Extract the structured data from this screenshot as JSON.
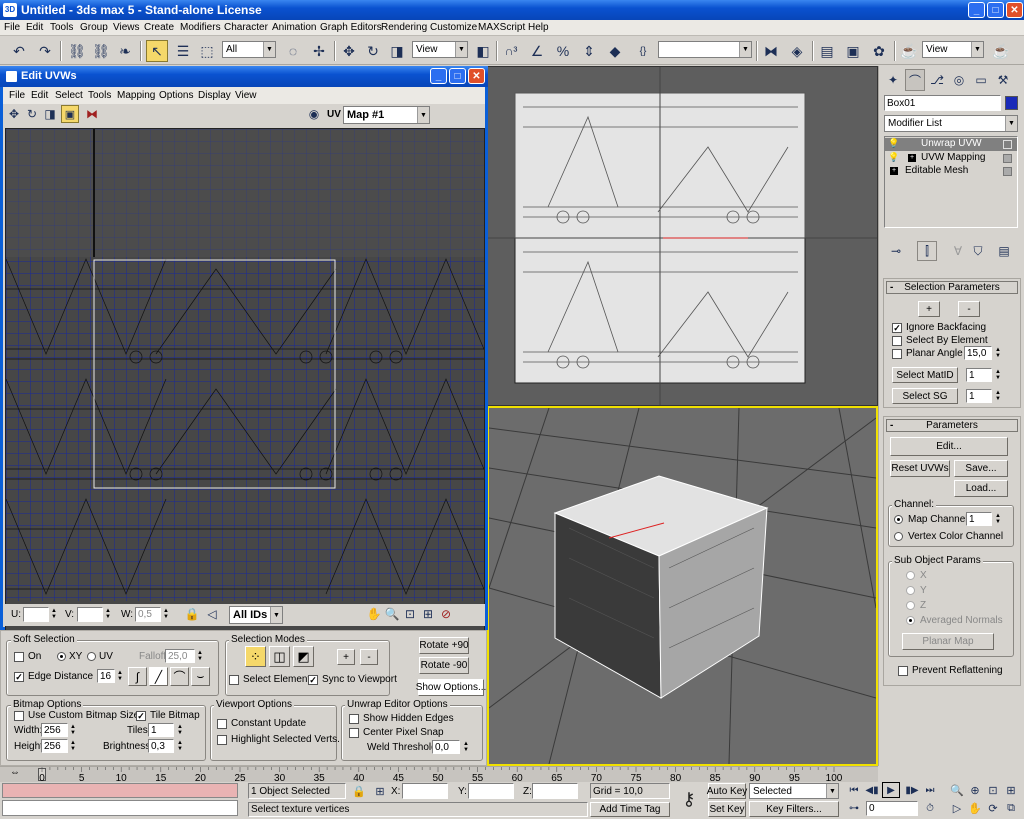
{
  "app": {
    "title": "Untitled - 3ds max 5 - Stand-alone License"
  },
  "menubar": [
    "File",
    "Edit",
    "Tools",
    "Group",
    "Views",
    "Create",
    "Modifiers",
    "Character",
    "Animation",
    "Graph Editors",
    "Rendering",
    "Customize",
    "MAXScript",
    "Help"
  ],
  "toolbar": {
    "selection_filter": "All",
    "ref_coord": "View",
    "named_sets": "",
    "render_type": "View"
  },
  "uvw_editor": {
    "title": "Edit UVWs",
    "menus": [
      "File",
      "Edit",
      "Select",
      "Tools",
      "Mapping",
      "Options",
      "Display",
      "View"
    ],
    "uv_label": "UV",
    "map": "Map #1",
    "u_label": "U:",
    "v_label": "V:",
    "w_label": "W:",
    "w_value": "0,5",
    "ids": "All IDs"
  },
  "soft_selection": {
    "title": "Soft Selection",
    "on": "On",
    "xy": "XY",
    "uv": "UV",
    "falloff_label": "Falloff:",
    "falloff": "25,0",
    "edge_distance": "Edge Distance",
    "edge_value": "16"
  },
  "selection_modes": {
    "title": "Selection Modes",
    "plus": "+",
    "minus": "-",
    "select_element": "Select Element",
    "sync": "Sync to Viewport"
  },
  "rotate": {
    "plus90": "Rotate +90",
    "minus90": "Rotate -90",
    "show_options": "Show Options..."
  },
  "bitmap_options": {
    "title": "Bitmap Options",
    "use_custom": "Use Custom Bitmap Size",
    "tile": "Tile Bitmap",
    "width_label": "Width:",
    "width": "256",
    "height_label": "Height:",
    "height": "256",
    "tiles_label": "Tiles:",
    "tiles": "1",
    "brightness_label": "Brightness:",
    "brightness": "0,3"
  },
  "viewport_options": {
    "title": "Viewport Options",
    "constant": "Constant Update",
    "highlight": "Highlight Selected Verts."
  },
  "unwrap_options": {
    "title": "Unwrap Editor Options",
    "hidden": "Show Hidden Edges",
    "center": "Center Pixel Snap",
    "weld_label": "Weld Threshold:",
    "weld": "0,0"
  },
  "command_panel": {
    "object_name": "Box01",
    "modifier_list": "Modifier List",
    "stack": [
      "Unwrap UVW",
      "UVW Mapping",
      "Editable Mesh"
    ],
    "selection_params": {
      "title": "Selection Parameters",
      "plus": "+",
      "minus": "-",
      "ignore_backfacing": "Ignore Backfacing",
      "select_by_element": "Select By Element",
      "planar_angle": "Planar Angle",
      "planar_value": "15,0",
      "select_matid": "Select MatID",
      "matid": "1",
      "select_sg": "Select SG",
      "sg": "1"
    },
    "parameters": {
      "title": "Parameters",
      "edit": "Edit...",
      "reset": "Reset UVWs",
      "save": "Save...",
      "load": "Load...",
      "channel_title": "Channel:",
      "map_channel": "Map Channel:",
      "map_channel_value": "1",
      "vertex_color": "Vertex Color Channel",
      "sub_title": "Sub Object Params",
      "x": "X",
      "y": "Y",
      "z": "Z",
      "averaged": "Averaged Normals",
      "planar_map": "Planar Map",
      "prevent": "Prevent Reflattening"
    }
  },
  "timeline": {
    "frame": "0",
    "ticks": [
      "0",
      "5",
      "10",
      "15",
      "20",
      "25",
      "30",
      "35",
      "40",
      "45",
      "50",
      "55",
      "60",
      "65",
      "70",
      "75",
      "80",
      "85",
      "90",
      "95",
      "100"
    ]
  },
  "status": {
    "selected": "1 Object Selected",
    "prompt": "Select texture vertices",
    "x": "X:",
    "y": "Y:",
    "z": "Z:",
    "grid": "Grid = 10,0",
    "add_time_tag": "Add Time Tag",
    "auto_key": "Auto Key",
    "set_key": "Set Key",
    "key_mode": "Selected",
    "key_filters": "Key Filters...",
    "current_frame": "0"
  },
  "colors": {
    "title_bar": "#0a5fd8",
    "uv_grid": "#1a2a9a",
    "uv_bg": "#444444",
    "viewport_active": "#f0e000",
    "app_bg": "#d6d3ce"
  }
}
